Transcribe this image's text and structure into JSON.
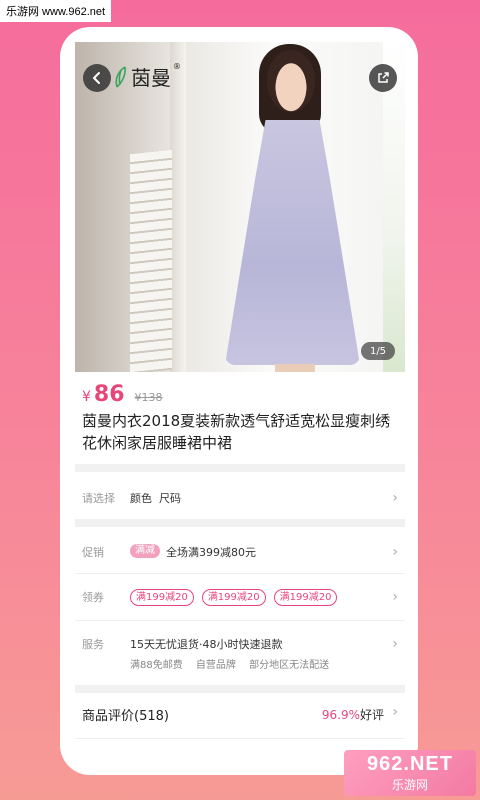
{
  "watermark": {
    "top_text": "乐游网 www.962.net",
    "bottom_big": "962.NET",
    "bottom_small": "乐游网"
  },
  "product": {
    "brand": "茵曼",
    "image_counter": "1/5",
    "price_currency": "¥",
    "price": "86",
    "original_price": "¥138",
    "title": "茵曼内衣2018夏装新款透气舒适宽松显瘦刺绣花休闲家居服睡裙中裙"
  },
  "select": {
    "label": "请选择",
    "value": "颜色  尺码"
  },
  "promotion": {
    "label": "促销",
    "tag": "满减",
    "text": "全场满399减80元"
  },
  "coupons": {
    "label": "领券",
    "items": [
      "满199减20",
      "满199减20",
      "满199减20"
    ]
  },
  "service": {
    "label": "服务",
    "main": "15天无忧退货·48小时快速退款",
    "subs": [
      "满88免邮费",
      "自营品牌",
      "部分地区无法配送"
    ]
  },
  "review": {
    "label": "商品评价(518)",
    "rate": "96.9%",
    "good_label": "好评"
  },
  "colors": {
    "accent": "#e8467a",
    "background_top": "#f56c9c",
    "background_bottom": "#f79b95"
  }
}
